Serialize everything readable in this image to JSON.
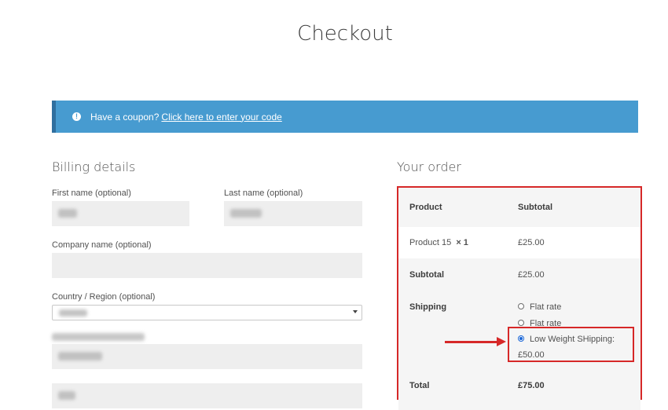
{
  "page": {
    "title": "Checkout"
  },
  "coupon": {
    "prompt": "Have a coupon?",
    "link": "Click here to enter your code"
  },
  "billing": {
    "heading": "Billing details",
    "first_name_label": "First name (optional)",
    "last_name_label": "Last name (optional)",
    "company_label": "Company name (optional)",
    "country_label": "Country / Region (optional)"
  },
  "order": {
    "heading": "Your order",
    "col_product": "Product",
    "col_subtotal": "Subtotal",
    "item_name": "Product 15",
    "item_qty": "× 1",
    "item_price": "£25.00",
    "subtotal_label": "Subtotal",
    "subtotal_value": "£25.00",
    "shipping_label": "Shipping",
    "shipping_options": [
      {
        "label": "Flat rate",
        "selected": false
      },
      {
        "label": "Flat rate",
        "selected": false
      },
      {
        "label": "Low Weight SHipping:",
        "price": "£50.00",
        "selected": true
      }
    ],
    "total_label": "Total",
    "total_value": "£75.00"
  },
  "colors": {
    "accent": "#479bd0",
    "annotation": "#d62828",
    "radio_selected": "#1a66d6"
  }
}
